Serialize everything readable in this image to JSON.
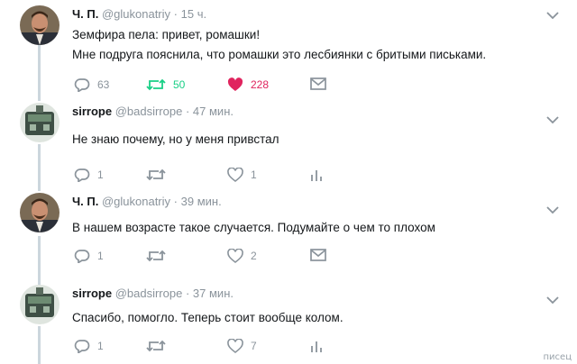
{
  "colors": {
    "retweet_active": "#19cf86",
    "like_active": "#e0245e",
    "icon_gray": "#8a939b",
    "thread_line": "#ccd6dd"
  },
  "tweets": [
    {
      "name": "Ч. П.",
      "handle": "@glukonatriy",
      "sep": "·",
      "time": "15 ч.",
      "lines": [
        "Земфира пела: привет, ромашки!",
        "Мне подруга пояснила, что ромашки это лесбиянки с бритыми письками."
      ],
      "replies": "63",
      "retweets": "50",
      "likes": "228",
      "fourth": "dm"
    },
    {
      "name": "sirrope",
      "handle": "@badsirrope",
      "sep": "·",
      "time": "47 мин.",
      "lines": [
        "Не знаю почему, но у меня привстал"
      ],
      "replies": "1",
      "retweets": "",
      "likes": "1",
      "fourth": "analytics"
    },
    {
      "name": "Ч. П.",
      "handle": "@glukonatriy",
      "sep": "·",
      "time": "39 мин.",
      "lines": [
        "В нашем возрасте такое случается. Подумайте о чем то плохом"
      ],
      "replies": "1",
      "retweets": "",
      "likes": "2",
      "fourth": "dm"
    },
    {
      "name": "sirrope",
      "handle": "@badsirrope",
      "sep": "·",
      "time": "37 мин.",
      "lines": [
        "Спасибо, помогло. Теперь стоит вообще колом."
      ],
      "replies": "1",
      "retweets": "",
      "likes": "7",
      "fourth": "analytics"
    }
  ],
  "watermark": "писец"
}
